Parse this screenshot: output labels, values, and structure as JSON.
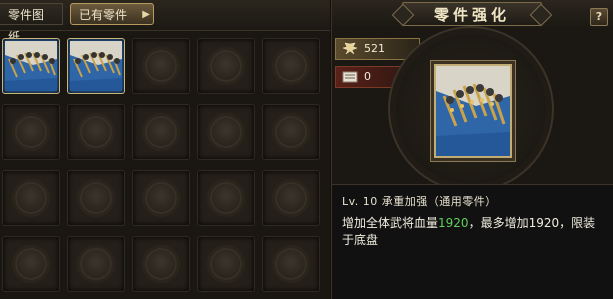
{
  "tabs": [
    {
      "label": "零件图纸"
    },
    {
      "label": "已有零件"
    }
  ],
  "grid": {
    "rows": 4,
    "cols": 5,
    "filled_slots": [
      0,
      1
    ]
  },
  "panel": {
    "title": "零件强化",
    "help_label": "?"
  },
  "resources": [
    {
      "icon": "gold-wings-icon",
      "value": "521"
    },
    {
      "icon": "scroll-icon",
      "value": "0"
    }
  ],
  "part": {
    "icon": "armored-troops-icon",
    "name": "Lv. 10 承重加强（通用零件）",
    "desc_prefix": "增加全体武将血量",
    "desc_value": "1920",
    "desc_suffix": "，最多增加1920，限装于底盘"
  },
  "colors": {
    "highlight_value": "#5fd05a",
    "item_bg": "#2f66a8",
    "frame_gold": "#c2ad74"
  }
}
